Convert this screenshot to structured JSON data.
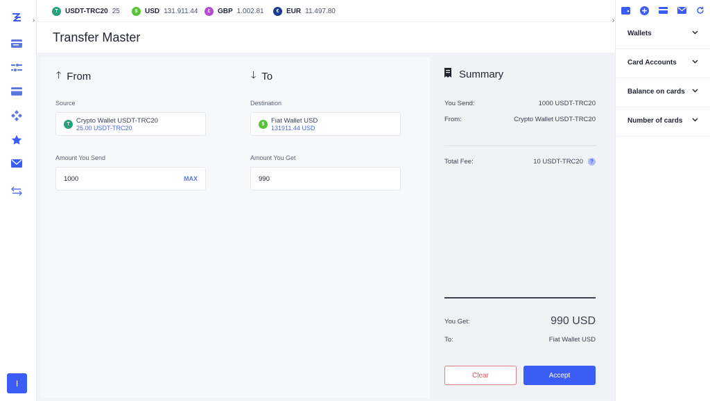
{
  "colors": {
    "accent": "#3b5cf5",
    "usdt": "#26a17b",
    "usd": "#57c437",
    "gbp": "#b94ad8",
    "eur": "#1a3a8f",
    "danger": "#d6555e"
  },
  "ticker": [
    {
      "symbol": "USDT-TRC20",
      "value": "25",
      "icon": "tether-coin-icon"
    },
    {
      "symbol": "USD",
      "value": "131.911.44",
      "icon": "dollar-coin-icon"
    },
    {
      "symbol": "GBP",
      "value": "1.002.81",
      "icon": "pound-coin-icon"
    },
    {
      "symbol": "EUR",
      "value": "11.497.80",
      "icon": "euro-coin-icon"
    }
  ],
  "page": {
    "title": "Transfer Master"
  },
  "from": {
    "heading": "From",
    "source_label": "Source",
    "source_name": "Crypto Wallet USDT-TRC20",
    "source_balance": "25.00 USDT-TRC20",
    "amount_label": "Amount You Send",
    "amount_value": "1000",
    "max_label": "MAX"
  },
  "to": {
    "heading": "To",
    "dest_label": "Destination",
    "dest_name": "Fiat Wallet USD",
    "dest_balance": "131911.44 USD",
    "amount_label": "Amount You Get",
    "amount_value": "990"
  },
  "summary": {
    "heading": "Summary",
    "send_label": "You Send:",
    "send_value": "1000 USDT-TRC20",
    "from_label": "From:",
    "from_value": "Crypto Wallet USDT-TRC20",
    "fee_label": "Total Fee:",
    "fee_value": "10 USDT-TRC20",
    "get_label": "You Get:",
    "get_value": "990 USD",
    "to_label": "To:",
    "to_value": "Fiat Wallet USD"
  },
  "buttons": {
    "clear": "Clear",
    "accept": "Accept"
  },
  "user": {
    "initial": "I"
  },
  "right_panel": {
    "sections": [
      "Wallets",
      "Card Accounts",
      "Balance on cards",
      "Number of cards"
    ]
  }
}
